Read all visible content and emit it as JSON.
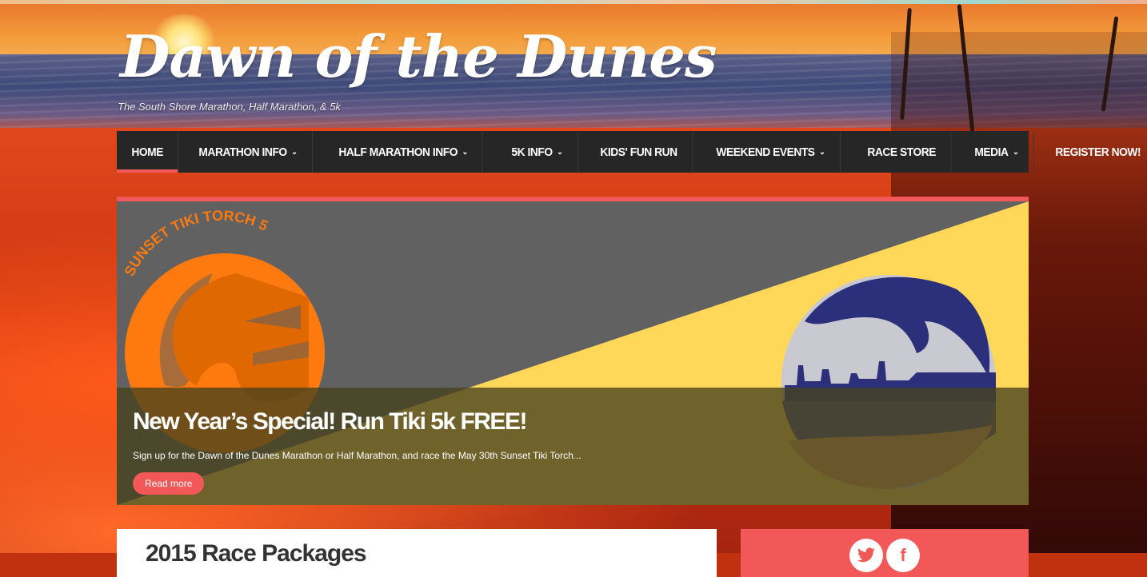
{
  "site": {
    "title": "Dawn of the Dunes",
    "tagline": "The South Shore Marathon, Half Marathon, & 5k"
  },
  "nav": {
    "items": [
      {
        "label": "HOME",
        "dropdown": false,
        "active": true
      },
      {
        "label": "MARATHON INFO",
        "dropdown": true
      },
      {
        "label": "HALF MARATHON INFO",
        "dropdown": true
      },
      {
        "label": "5K INFO",
        "dropdown": true
      },
      {
        "label": "KIDS' FUN RUN",
        "dropdown": false
      },
      {
        "label": "WEEKEND EVENTS",
        "dropdown": true
      },
      {
        "label": "RACE STORE",
        "dropdown": false
      },
      {
        "label": "MEDIA",
        "dropdown": true
      },
      {
        "label": "REGISTER NOW!",
        "dropdown": false
      }
    ],
    "chevron": "⌄"
  },
  "slider": {
    "logo_left_text": "SUNSET TIKI TORCH 5K",
    "title": "New Year’s Special! Run Tiki 5k FREE!",
    "text": "Sign up for the Dawn of the Dunes Marathon or Half Marathon, and race the May 30th Sunset Tiki Torch...",
    "button_label": "Read more"
  },
  "post": {
    "title": "2015 Race Packages"
  },
  "social": {
    "twitter_icon": "twitter-icon",
    "facebook_icon": "facebook-icon",
    "facebook_glyph": "f"
  },
  "colors": {
    "accent": "#f25858",
    "nav_bg": "#262626",
    "slider_yellow": "#ffd85a",
    "slider_gray": "#616161",
    "tiki_orange": "#ff7a0e",
    "navy": "#2c2f7a"
  }
}
